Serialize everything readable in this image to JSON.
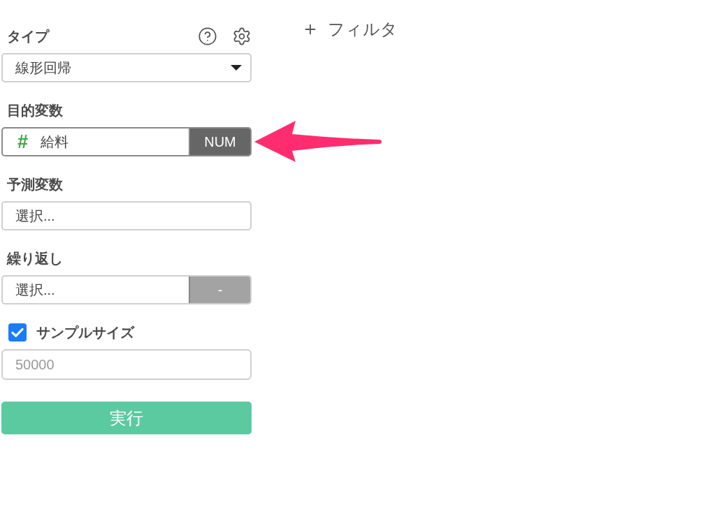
{
  "fields": [
    {
      "kind": "select",
      "label": "タイプ",
      "value": "線形回帰"
    },
    {
      "kind": "typed_column",
      "label": "目的変数",
      "symbol": "#",
      "value": "給料",
      "type_badge": "NUM"
    },
    {
      "kind": "multi_select",
      "label": "予測変数",
      "placeholder": "選択..."
    },
    {
      "kind": "select_with_button",
      "label": "繰り返し",
      "placeholder": "選択...",
      "side_button": {
        "label": "-",
        "disabled": true
      }
    },
    {
      "kind": "checked_number",
      "label": "サンプルサイズ",
      "checked": true,
      "placeholder": "50000"
    }
  ],
  "run_button": {
    "label": "実行"
  },
  "filter_button": {
    "label": "フィルタ"
  }
}
